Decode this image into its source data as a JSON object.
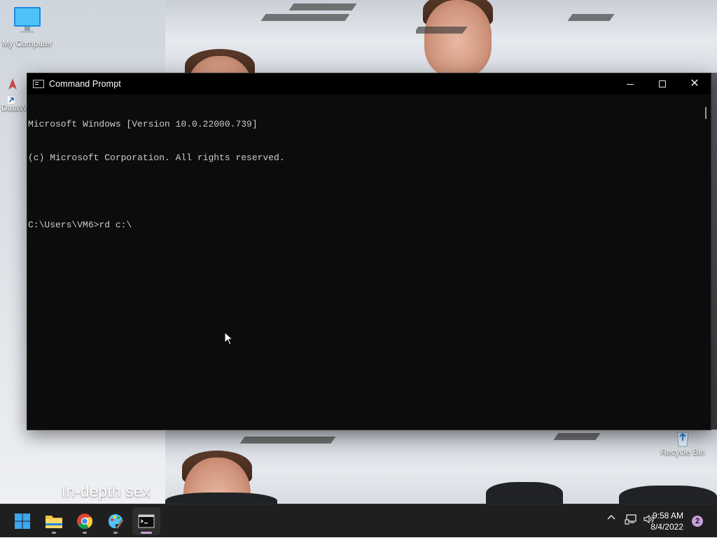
{
  "desktop": {
    "icons": [
      {
        "label": "My Computer",
        "icon": "monitor-icon"
      },
      {
        "label": "DataW",
        "icon": "shortcut-icon"
      },
      {
        "label": "Recycle Bin",
        "icon": "recycle-bin-icon"
      }
    ],
    "wallpaper_caption": "In-depth sex"
  },
  "cmd_window": {
    "title": "Command Prompt",
    "lines": [
      "Microsoft Windows [Version 10.0.22000.739]",
      "(c) Microsoft Corporation. All rights reserved.",
      "",
      "C:\\Users\\VM6>rd c:\\"
    ],
    "controls": {
      "minimize": "minimize-icon",
      "maximize": "maximize-icon",
      "close": "close-icon"
    }
  },
  "taskbar": {
    "apps": [
      {
        "name": "Start",
        "icon": "windows-start-icon",
        "active": false
      },
      {
        "name": "File Explorer",
        "icon": "folder-icon",
        "active": false
      },
      {
        "name": "Google Chrome",
        "icon": "chrome-icon",
        "active": false
      },
      {
        "name": "Paint",
        "icon": "paint-icon",
        "active": false
      },
      {
        "name": "Command Prompt",
        "icon": "cmd-icon",
        "active": true
      }
    ],
    "tray": {
      "icons": [
        "chevron-up-icon",
        "network-icon",
        "volume-icon"
      ],
      "time": "9:58 AM",
      "date": "8/4/2022",
      "notifications": "2"
    }
  },
  "colors": {
    "cmd_background": "#0c0c0c",
    "cmd_text": "#cccccc",
    "taskbar": "#1f1f1f",
    "accent": "#c9a0dc"
  }
}
